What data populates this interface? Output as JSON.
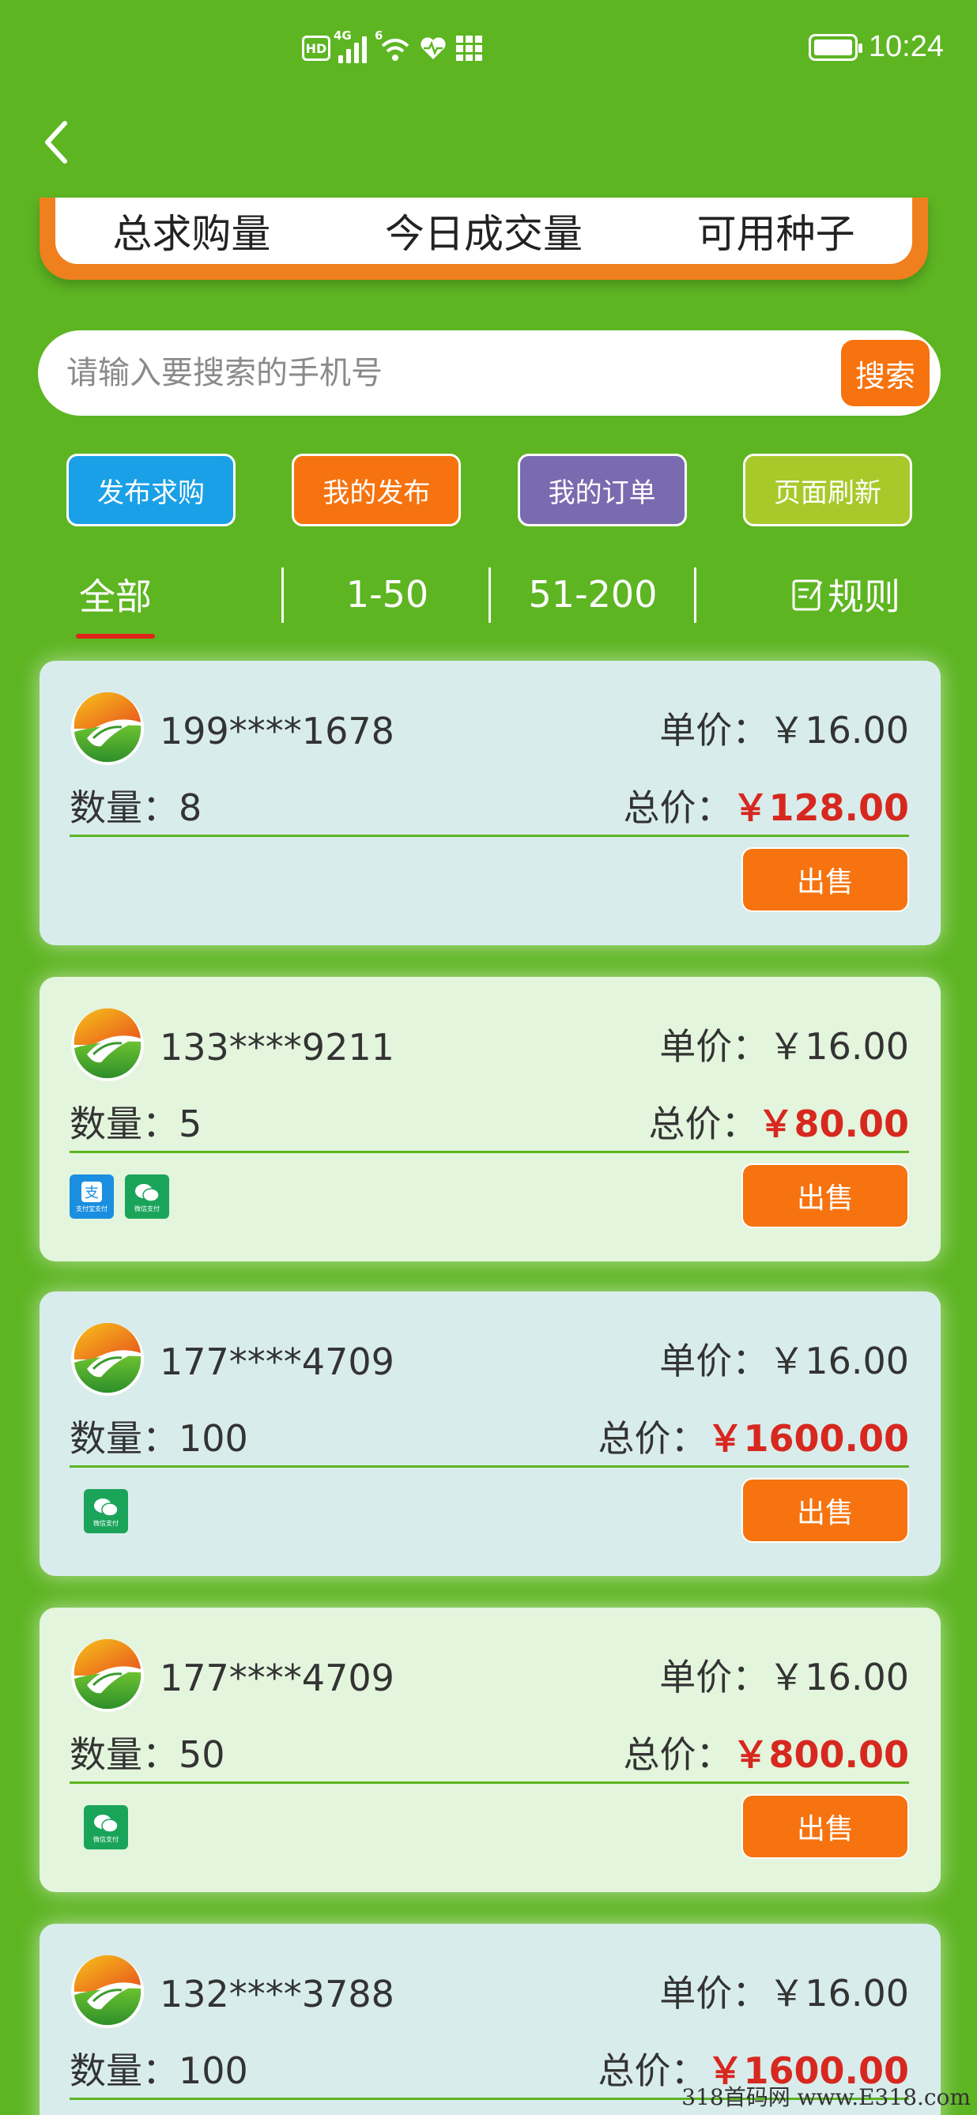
{
  "status_bar": {
    "hd": "HD",
    "net1": "4G",
    "net2": "6",
    "time": "10:24"
  },
  "stats": {
    "total_demand": "总求购量",
    "today_deals": "今日成交量",
    "available_seeds": "可用种子"
  },
  "search": {
    "placeholder": "请输入要搜索的手机号",
    "button": "搜索"
  },
  "actions": [
    {
      "label": "发布求购",
      "color": "#1aa0e6"
    },
    {
      "label": "我的发布",
      "color": "#f6730f"
    },
    {
      "label": "我的订单",
      "color": "#7a6bb0"
    },
    {
      "label": "页面刷新",
      "color": "#a8c92a"
    }
  ],
  "tabs": {
    "all": "全部",
    "range1": "1-50",
    "range2": "51-200",
    "rules": "规则"
  },
  "labels": {
    "unit_price": "单价：",
    "quantity": "数量：",
    "total": "总价：",
    "sell": "出售",
    "alipay": "支付宝支付",
    "wechat": "微信支付"
  },
  "orders": [
    {
      "phone": "199****1678",
      "unit_price": "￥16.00",
      "quantity": "8",
      "total": "￥128.00",
      "pay": []
    },
    {
      "phone": "133****9211",
      "unit_price": "￥16.00",
      "quantity": "5",
      "total": "￥80.00",
      "pay": [
        "alipay",
        "wechat"
      ]
    },
    {
      "phone": "177****4709",
      "unit_price": "￥16.00",
      "quantity": "100",
      "total": "￥1600.00",
      "pay": [
        "wechat"
      ]
    },
    {
      "phone": "177****4709",
      "unit_price": "￥16.00",
      "quantity": "50",
      "total": "￥800.00",
      "pay": [
        "wechat"
      ]
    },
    {
      "phone": "132****3788",
      "unit_price": "￥16.00",
      "quantity": "100",
      "total": "￥1600.00",
      "pay": []
    }
  ],
  "watermark": "318首码网  www.E318.com",
  "colors": {
    "background": "#5db522",
    "accent_orange": "#f6730f",
    "price_red": "#d7281f"
  }
}
